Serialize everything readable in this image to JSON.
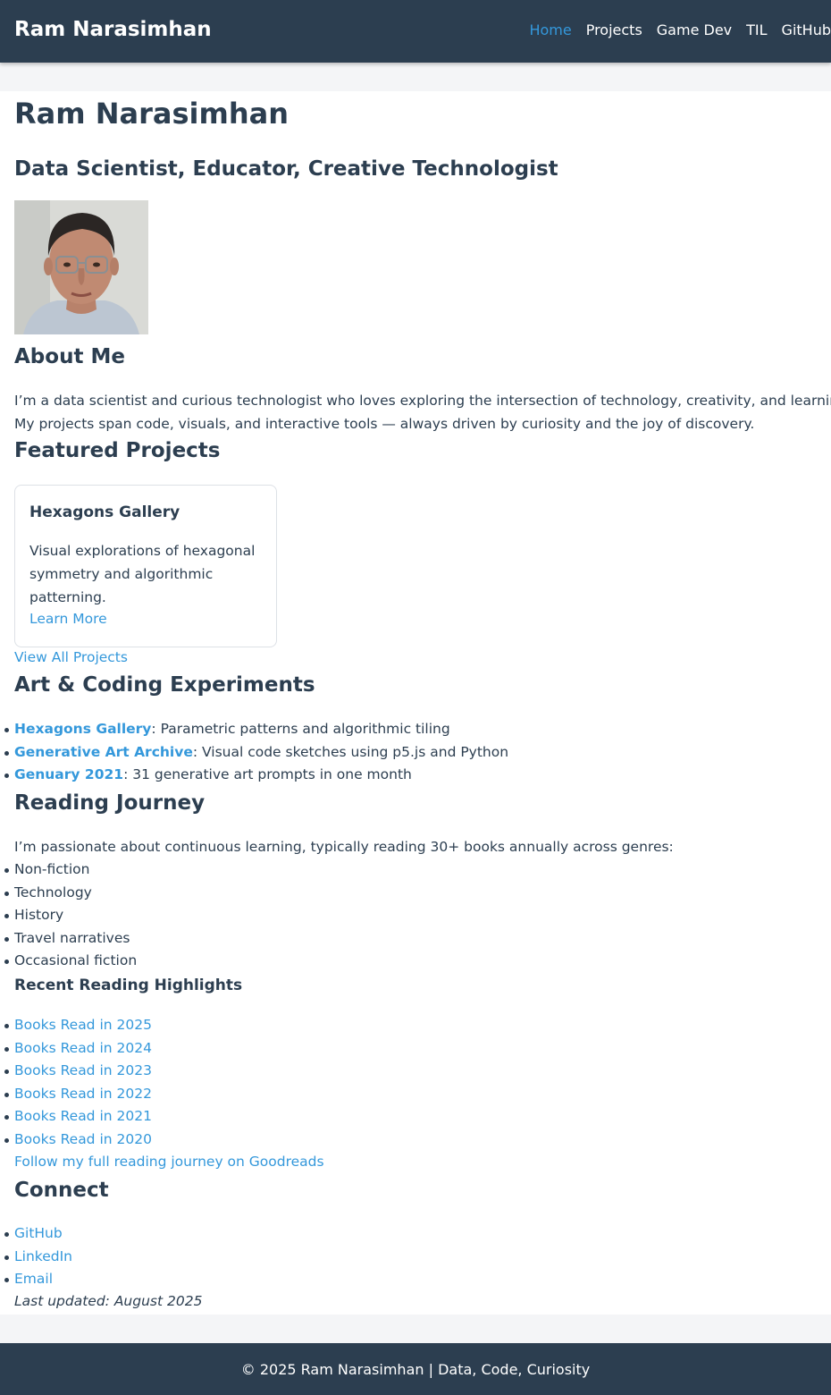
{
  "nav": {
    "brand": "Ram Narasimhan",
    "links": [
      "Home",
      "Projects",
      "Game Dev",
      "TIL",
      "GitHub"
    ]
  },
  "hero": {
    "name": "Ram Narasimhan",
    "tagline": "Data Scientist, Educator, Creative Technologist"
  },
  "about": {
    "heading": "About Me",
    "line1": "I’m a data scientist and curious technologist who loves exploring the intersection of technology, creativity, and learning.",
    "line2": "My projects span code, visuals, and interactive tools — always driven by curiosity and the joy of discovery."
  },
  "featured": {
    "heading": "Featured Projects",
    "card": {
      "title": "Hexagons Gallery",
      "description": "Visual explorations of hexagonal symmetry and algorithmic patterning.",
      "link": "Learn More"
    },
    "view_all": "View All Projects"
  },
  "art": {
    "heading": "Art & Coding Experiments",
    "items": [
      {
        "link": "Hexagons Gallery",
        "text": ": Parametric patterns and algorithmic tiling"
      },
      {
        "link": "Generative Art Archive",
        "text": ": Visual code sketches using p5.js and Python"
      },
      {
        "link": "Genuary 2021",
        "text": ": 31 generative art prompts in one month"
      }
    ]
  },
  "reading": {
    "heading": "Reading Journey",
    "intro": "I’m passionate about continuous learning, typically reading 30+ books annually across genres:",
    "genres": [
      "Non-fiction",
      "Technology",
      "History",
      "Travel narratives",
      "Occasional fiction"
    ],
    "highlights_heading": "Recent Reading Highlights",
    "highlights": [
      "Books Read in 2025",
      "Books Read in 2024",
      "Books Read in 2023",
      "Books Read in 2022",
      "Books Read in 2021",
      "Books Read in 2020"
    ],
    "goodreads": "Follow my full reading journey on Goodreads"
  },
  "connect": {
    "heading": "Connect",
    "links": [
      "GitHub",
      "LinkedIn",
      "Email"
    ]
  },
  "last_updated": "Last updated: August 2025",
  "footer": "© 2025 Ram Narasimhan | Data, Code, Curiosity",
  "colors": {
    "navbar": "#2c3e50",
    "accent": "#3498db",
    "text": "#2c3e50",
    "page_bg": "#f4f5f7"
  }
}
